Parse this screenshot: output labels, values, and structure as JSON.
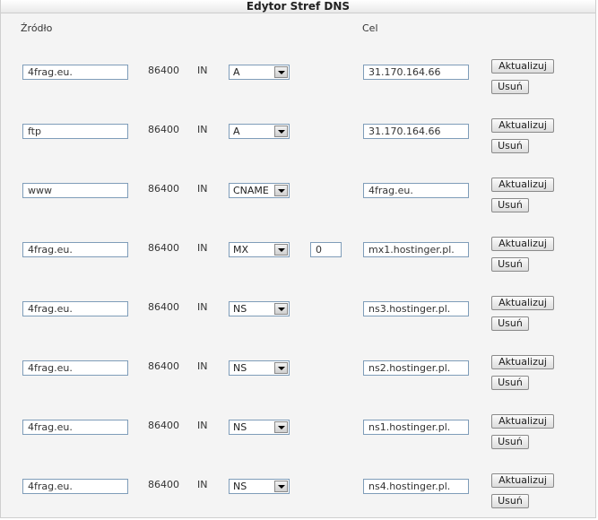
{
  "title": "Edytor Stref DNS",
  "headers": {
    "source": "Źródło",
    "target": "Cel"
  },
  "update_label": "Aktualizuj",
  "delete_label": "Usuń",
  "records": [
    {
      "name": "4frag.eu.",
      "ttl": "86400",
      "class": "IN",
      "type": "A",
      "priority": "",
      "target": "31.170.164.66"
    },
    {
      "name": "ftp",
      "ttl": "86400",
      "class": "IN",
      "type": "A",
      "priority": "",
      "target": "31.170.164.66"
    },
    {
      "name": "www",
      "ttl": "86400",
      "class": "IN",
      "type": "CNAME",
      "priority": "",
      "target": "4frag.eu."
    },
    {
      "name": "4frag.eu.",
      "ttl": "86400",
      "class": "IN",
      "type": "MX",
      "priority": "0",
      "target": "mx1.hostinger.pl."
    },
    {
      "name": "4frag.eu.",
      "ttl": "86400",
      "class": "IN",
      "type": "NS",
      "priority": "",
      "target": "ns3.hostinger.pl."
    },
    {
      "name": "4frag.eu.",
      "ttl": "86400",
      "class": "IN",
      "type": "NS",
      "priority": "",
      "target": "ns2.hostinger.pl."
    },
    {
      "name": "4frag.eu.",
      "ttl": "86400",
      "class": "IN",
      "type": "NS",
      "priority": "",
      "target": "ns1.hostinger.pl."
    },
    {
      "name": "4frag.eu.",
      "ttl": "86400",
      "class": "IN",
      "type": "NS",
      "priority": "",
      "target": "ns4.hostinger.pl."
    }
  ]
}
